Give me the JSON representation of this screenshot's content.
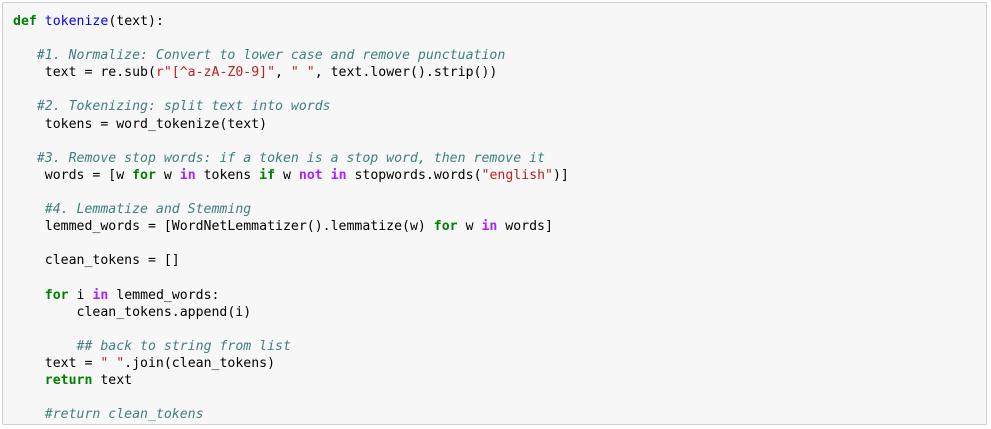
{
  "code_lines": [
    [
      {
        "t": "def",
        "c": "kw"
      },
      {
        "t": " "
      },
      {
        "t": "tokenize",
        "c": "fn"
      },
      {
        "t": "(text):"
      }
    ],
    [],
    [
      {
        "t": "   "
      },
      {
        "t": "#1. Normalize: Convert to lower case and remove punctuation",
        "c": "cm"
      }
    ],
    [
      {
        "t": "    text = re.sub("
      },
      {
        "t": "r\"[^a-zA-Z0-9]\"",
        "c": "st"
      },
      {
        "t": ", "
      },
      {
        "t": "\" \"",
        "c": "st"
      },
      {
        "t": ", text.lower().strip())"
      }
    ],
    [],
    [
      {
        "t": "   "
      },
      {
        "t": "#2. Tokenizing: split text into words",
        "c": "cm"
      }
    ],
    [
      {
        "t": "    tokens = word_tokenize(text)"
      }
    ],
    [],
    [
      {
        "t": "   "
      },
      {
        "t": "#3. Remove stop words: if a token is a stop word, then remove it",
        "c": "cm"
      }
    ],
    [
      {
        "t": "    words = [w "
      },
      {
        "t": "for",
        "c": "kw"
      },
      {
        "t": " w "
      },
      {
        "t": "in",
        "c": "op"
      },
      {
        "t": " tokens "
      },
      {
        "t": "if",
        "c": "kw"
      },
      {
        "t": " w "
      },
      {
        "t": "not in",
        "c": "op"
      },
      {
        "t": " stopwords.words("
      },
      {
        "t": "\"english\"",
        "c": "st"
      },
      {
        "t": ")]"
      }
    ],
    [],
    [
      {
        "t": "    "
      },
      {
        "t": "#4. Lemmatize and Stemming",
        "c": "cm"
      }
    ],
    [
      {
        "t": "    lemmed_words = [WordNetLemmatizer().lemmatize(w) "
      },
      {
        "t": "for",
        "c": "kw"
      },
      {
        "t": " w "
      },
      {
        "t": "in",
        "c": "op"
      },
      {
        "t": " words]"
      }
    ],
    [],
    [
      {
        "t": "    clean_tokens = []"
      }
    ],
    [],
    [
      {
        "t": "    "
      },
      {
        "t": "for",
        "c": "kw"
      },
      {
        "t": " i "
      },
      {
        "t": "in",
        "c": "op"
      },
      {
        "t": " lemmed_words:"
      }
    ],
    [
      {
        "t": "        clean_tokens.append(i)"
      }
    ],
    [],
    [
      {
        "t": "        "
      },
      {
        "t": "## back to string from list",
        "c": "cm"
      }
    ],
    [
      {
        "t": "    text = "
      },
      {
        "t": "\" \"",
        "c": "st"
      },
      {
        "t": ".join(clean_tokens)"
      }
    ],
    [
      {
        "t": "    "
      },
      {
        "t": "return",
        "c": "kw"
      },
      {
        "t": " text"
      }
    ],
    [],
    [
      {
        "t": "    "
      },
      {
        "t": "#return clean_tokens",
        "c": "cm"
      }
    ]
  ]
}
